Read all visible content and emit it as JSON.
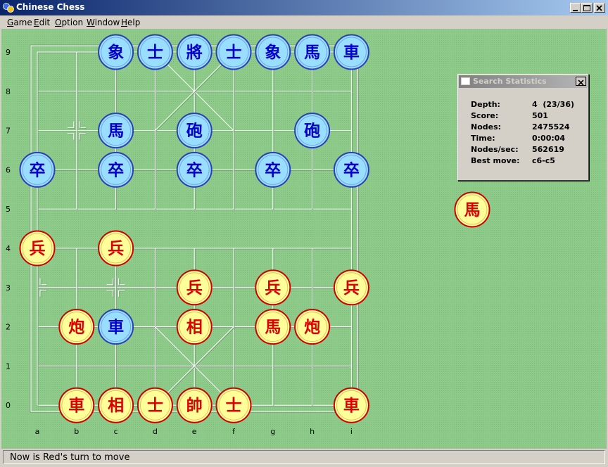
{
  "window": {
    "title": "Chinese Chess"
  },
  "menu": [
    {
      "pre": "",
      "ul": "G",
      "post": "ame"
    },
    {
      "pre": "",
      "ul": "E",
      "post": "dit"
    },
    {
      "pre": "",
      "ul": "O",
      "post": "ption"
    },
    {
      "pre": "",
      "ul": "W",
      "post": "indow"
    },
    {
      "pre": "",
      "ul": "H",
      "post": "elp"
    }
  ],
  "board": {
    "files": [
      "a",
      "b",
      "c",
      "d",
      "e",
      "f",
      "g",
      "h",
      "i"
    ],
    "ranks": [
      "0",
      "1",
      "2",
      "3",
      "4",
      "5",
      "6",
      "7",
      "8",
      "9"
    ],
    "colors": {
      "background": "#8ecb8a",
      "grid": "#ffffff",
      "gridShadow": "#7a9c78",
      "bluePiece": "#99ddff",
      "blueText": "#0000cc",
      "blueBorder": "#2a3fb8",
      "redPiece": "#ffff99",
      "redText": "#dd0000",
      "redBorder": "#cc0000"
    },
    "pieces": [
      {
        "char": "象",
        "side": "blue",
        "file": 2,
        "rank": 9
      },
      {
        "char": "士",
        "side": "blue",
        "file": 3,
        "rank": 9
      },
      {
        "char": "將",
        "side": "blue",
        "file": 4,
        "rank": 9
      },
      {
        "char": "士",
        "side": "blue",
        "file": 5,
        "rank": 9
      },
      {
        "char": "象",
        "side": "blue",
        "file": 6,
        "rank": 9
      },
      {
        "char": "馬",
        "side": "blue",
        "file": 7,
        "rank": 9
      },
      {
        "char": "車",
        "side": "blue",
        "file": 8,
        "rank": 9
      },
      {
        "char": "馬",
        "side": "blue",
        "file": 2,
        "rank": 7
      },
      {
        "char": "砲",
        "side": "blue",
        "file": 4,
        "rank": 7
      },
      {
        "char": "砲",
        "side": "blue",
        "file": 7,
        "rank": 7
      },
      {
        "char": "卒",
        "side": "blue",
        "file": 0,
        "rank": 6
      },
      {
        "char": "卒",
        "side": "blue",
        "file": 2,
        "rank": 6
      },
      {
        "char": "卒",
        "side": "blue",
        "file": 4,
        "rank": 6
      },
      {
        "char": "卒",
        "side": "blue",
        "file": 6,
        "rank": 6
      },
      {
        "char": "卒",
        "side": "blue",
        "file": 8,
        "rank": 6
      },
      {
        "char": "兵",
        "side": "red",
        "file": 0,
        "rank": 4
      },
      {
        "char": "兵",
        "side": "red",
        "file": 2,
        "rank": 4
      },
      {
        "char": "兵",
        "side": "red",
        "file": 4,
        "rank": 3
      },
      {
        "char": "兵",
        "side": "red",
        "file": 6,
        "rank": 3
      },
      {
        "char": "兵",
        "side": "red",
        "file": 8,
        "rank": 3
      },
      {
        "char": "炮",
        "side": "red",
        "file": 1,
        "rank": 2
      },
      {
        "char": "車",
        "side": "blue",
        "file": 2,
        "rank": 2
      },
      {
        "char": "相",
        "side": "red",
        "file": 4,
        "rank": 2
      },
      {
        "char": "馬",
        "side": "red",
        "file": 6,
        "rank": 2
      },
      {
        "char": "炮",
        "side": "red",
        "file": 7,
        "rank": 2
      },
      {
        "char": "車",
        "side": "red",
        "file": 1,
        "rank": 0
      },
      {
        "char": "相",
        "side": "red",
        "file": 2,
        "rank": 0
      },
      {
        "char": "士",
        "side": "red",
        "file": 3,
        "rank": 0
      },
      {
        "char": "帥",
        "side": "red",
        "file": 4,
        "rank": 0
      },
      {
        "char": "士",
        "side": "red",
        "file": 5,
        "rank": 0
      },
      {
        "char": "車",
        "side": "red",
        "file": 8,
        "rank": 0
      }
    ],
    "captured": [
      {
        "char": "馬",
        "side": "red"
      }
    ]
  },
  "stats": {
    "title": "Search Statistics",
    "rows": [
      {
        "label": "Depth:",
        "value": "4  (23/36)"
      },
      {
        "label": "Score:",
        "value": "501"
      },
      {
        "label": "Nodes:",
        "value": "2475524"
      },
      {
        "label": "Time:",
        "value": "0:00:04"
      },
      {
        "label": "Nodes/sec:",
        "value": "562619"
      },
      {
        "label": "Best move:",
        "value": "c6-c5"
      }
    ]
  },
  "status": {
    "text": "Now is Red's turn to move"
  }
}
